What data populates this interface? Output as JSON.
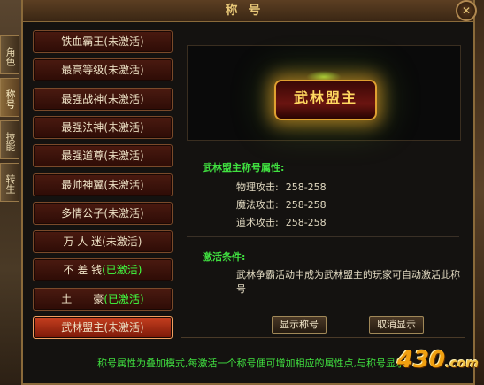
{
  "window": {
    "title": "称号"
  },
  "side_tabs": [
    "角色",
    "称号",
    "技能",
    "转生"
  ],
  "titles": [
    {
      "name": "铁血霸王",
      "status": "(未激活)",
      "active": false,
      "selected": false
    },
    {
      "name": "最高等级",
      "status": "(未激活)",
      "active": false,
      "selected": false
    },
    {
      "name": "最强战神",
      "status": "(未激活)",
      "active": false,
      "selected": false
    },
    {
      "name": "最强法神",
      "status": "(未激活)",
      "active": false,
      "selected": false
    },
    {
      "name": "最强道尊",
      "status": "(未激活)",
      "active": false,
      "selected": false
    },
    {
      "name": "最帅神翼",
      "status": "(未激活)",
      "active": false,
      "selected": false
    },
    {
      "name": "多情公子",
      "status": "(未激活)",
      "active": false,
      "selected": false
    },
    {
      "name": "万 人 迷",
      "status": "(未激活)",
      "active": false,
      "selected": false
    },
    {
      "name": "不 差 钱",
      "status": "(已激活)",
      "active": true,
      "selected": false
    },
    {
      "name": "土　　豪",
      "status": "(已激活)",
      "active": true,
      "selected": false
    },
    {
      "name": "武林盟主",
      "status": "(未激活)",
      "active": false,
      "selected": true
    }
  ],
  "preview": {
    "emblem_text": "武林盟主"
  },
  "attributes": {
    "heading": "武林盟主称号属性:",
    "rows": [
      {
        "label": "物理攻击:",
        "value": "258-258"
      },
      {
        "label": "魔法攻击:",
        "value": "258-258"
      },
      {
        "label": "道术攻击:",
        "value": "258-258"
      }
    ]
  },
  "condition": {
    "heading": "激活条件:",
    "text": "武林争霸活动中成为武林盟主的玩家可自动激活此称号"
  },
  "buttons": {
    "show": "显示称号",
    "hide": "取消显示"
  },
  "footer": "称号属性为叠加模式,每激活一个称号便可增加相应的属性点,与称号显示",
  "watermark": {
    "main": "430",
    "suffix": ".com"
  },
  "colors": {
    "active_green": "#40ff40",
    "selected_red": "#c84020",
    "heading_green": "#40e040"
  }
}
